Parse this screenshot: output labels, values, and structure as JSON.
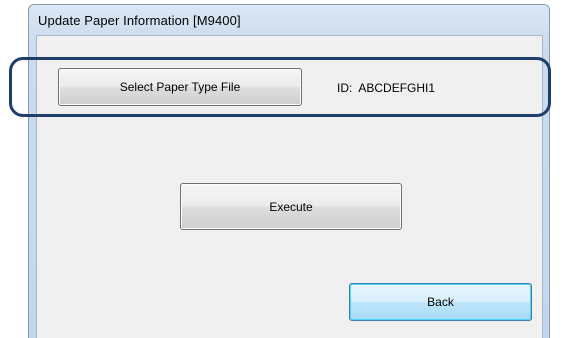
{
  "window": {
    "title": "Update Paper Information [M9400]"
  },
  "dialog": {
    "select_button_label": "Select Paper Type File",
    "id_prefix": "ID:",
    "id_value": "ABCDEFGHI1",
    "execute_button_label": "Execute",
    "back_button_label": "Back"
  },
  "colors": {
    "highlight_border": "#1f3f6a",
    "default_button_border": "#3c7fb1"
  }
}
